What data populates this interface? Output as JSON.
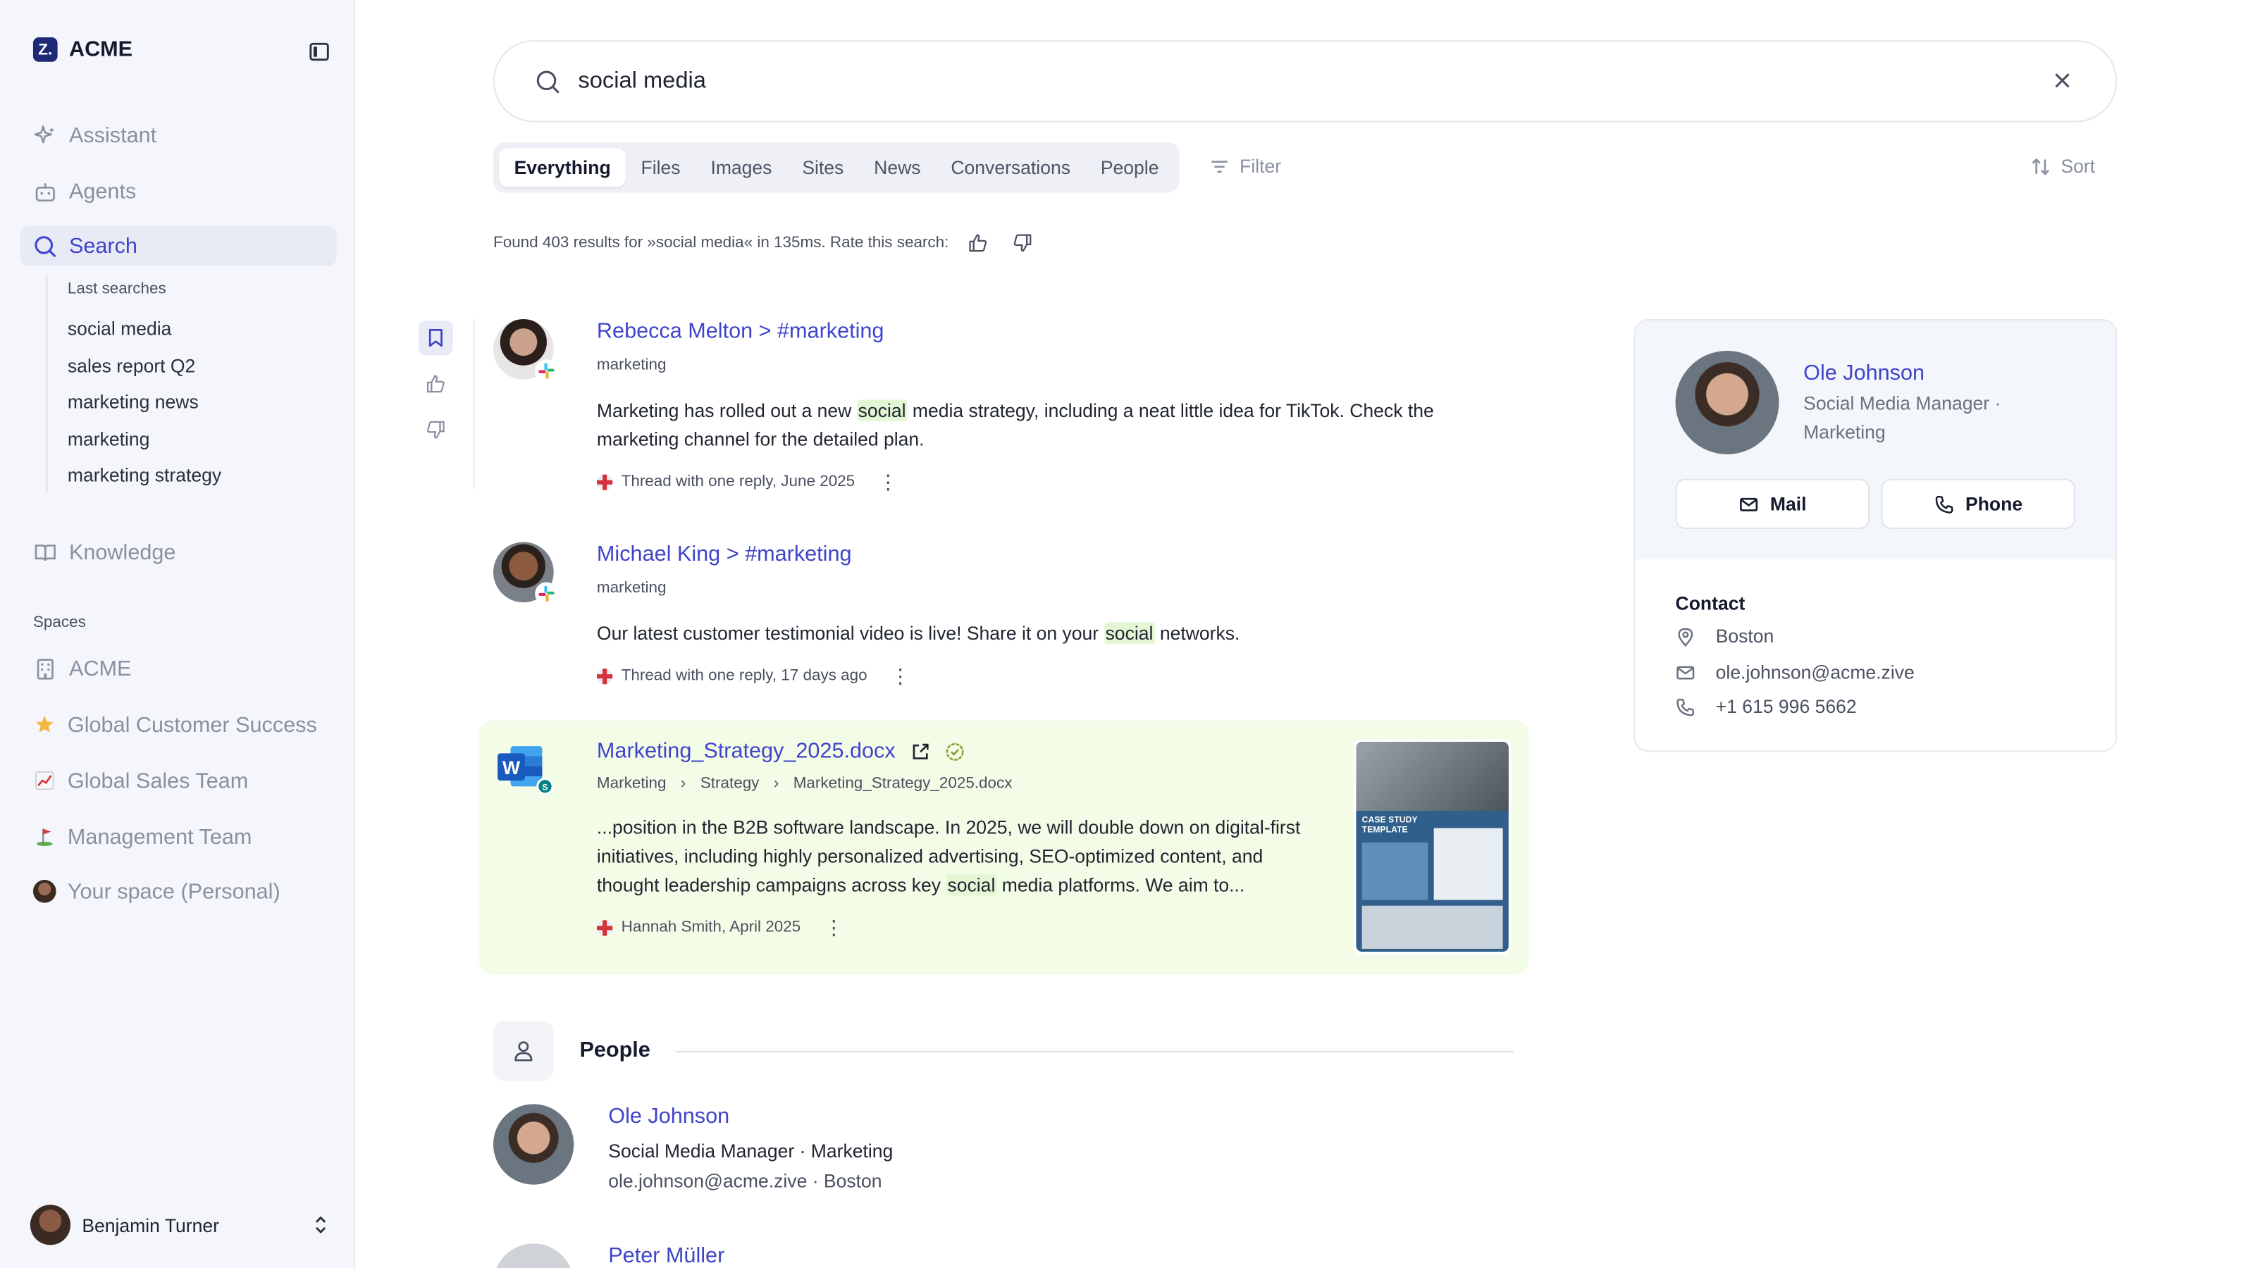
{
  "brand": {
    "name": "ACME",
    "logo_letter": "Z."
  },
  "sidebar": {
    "nav": [
      {
        "label": "Assistant",
        "icon": "sparkle-icon"
      },
      {
        "label": "Agents",
        "icon": "robot-icon"
      },
      {
        "label": "Search",
        "icon": "search-icon",
        "active": true
      }
    ],
    "last_searches_label": "Last searches",
    "recent": [
      "social media",
      "sales report Q2",
      "marketing news",
      "marketing",
      "marketing strategy"
    ],
    "knowledge_label": "Knowledge",
    "spaces_label": "Spaces",
    "spaces": [
      {
        "label": "ACME",
        "icon": "building-icon"
      },
      {
        "label": "Global Customer Success",
        "icon": "star-emoji"
      },
      {
        "label": "Global Sales Team",
        "icon": "chart-emoji"
      },
      {
        "label": "Management Team",
        "icon": "golf-flag-emoji"
      },
      {
        "label": "Your space (Personal)",
        "icon": "avatar"
      }
    ],
    "user": {
      "name": "Benjamin Turner"
    }
  },
  "search": {
    "query": "social media"
  },
  "tabs": [
    "Everything",
    "Files",
    "Images",
    "Sites",
    "News",
    "Conversations",
    "People"
  ],
  "active_tab": "Everything",
  "filter_label": "Filter",
  "sort_label": "Sort",
  "results_info": "Found 403 results for »social media« in 135ms. Rate this search:",
  "results": [
    {
      "title": "Rebecca Melton > #marketing",
      "subtitle": "marketing",
      "body_pre": "Marketing has rolled out a new ",
      "body_hl": "social",
      "body_post": " media strategy, including a neat little idea for TikTok. Check the marketing channel for the detailed plan.",
      "meta": "Thread with one reply, June 2025",
      "source": "slack"
    },
    {
      "title": "Michael King > #marketing",
      "subtitle": "marketing",
      "body_pre": "Our latest customer testimonial video is live! Share it on your ",
      "body_hl": "social",
      "body_post": " networks.",
      "meta": "Thread with one reply, 17 days ago",
      "source": "slack"
    },
    {
      "title": "Marketing_Strategy_2025.docx",
      "breadcrumb": [
        "Marketing",
        "Strategy",
        "Marketing_Strategy_2025.docx"
      ],
      "body_pre": "...position in the B2B software landscape. In 2025, we will double down on digital-first initiatives, including highly personalized advertising, SEO-optimized content, and thought leadership campaigns across key ",
      "body_hl": "social",
      "body_post": " media platforms. We aim to...",
      "meta": "Hannah Smith, April 2025",
      "source": "word",
      "thumbnail": {
        "label": "CASE STUDY TEMPLATE"
      }
    }
  ],
  "people_section": {
    "label": "People",
    "people": [
      {
        "name": "Ole Johnson",
        "role": "Social Media Manager · Marketing",
        "contact": "ole.johnson@acme.zive · Boston"
      },
      {
        "name": "Peter Müller"
      }
    ]
  },
  "profile": {
    "name": "Ole Johnson",
    "role": "Social Media Manager · Marketing",
    "mail_label": "Mail",
    "phone_label": "Phone",
    "contact_title": "Contact",
    "location": "Boston",
    "email": "ole.johnson@acme.zive",
    "phone": "+1 615 996 5662"
  },
  "colors": {
    "accent": "#3f44c9",
    "highlight": "#e4f7d4",
    "doc_card_bg": "#f3fce6",
    "sidebar_bg": "#f4f6fb"
  }
}
